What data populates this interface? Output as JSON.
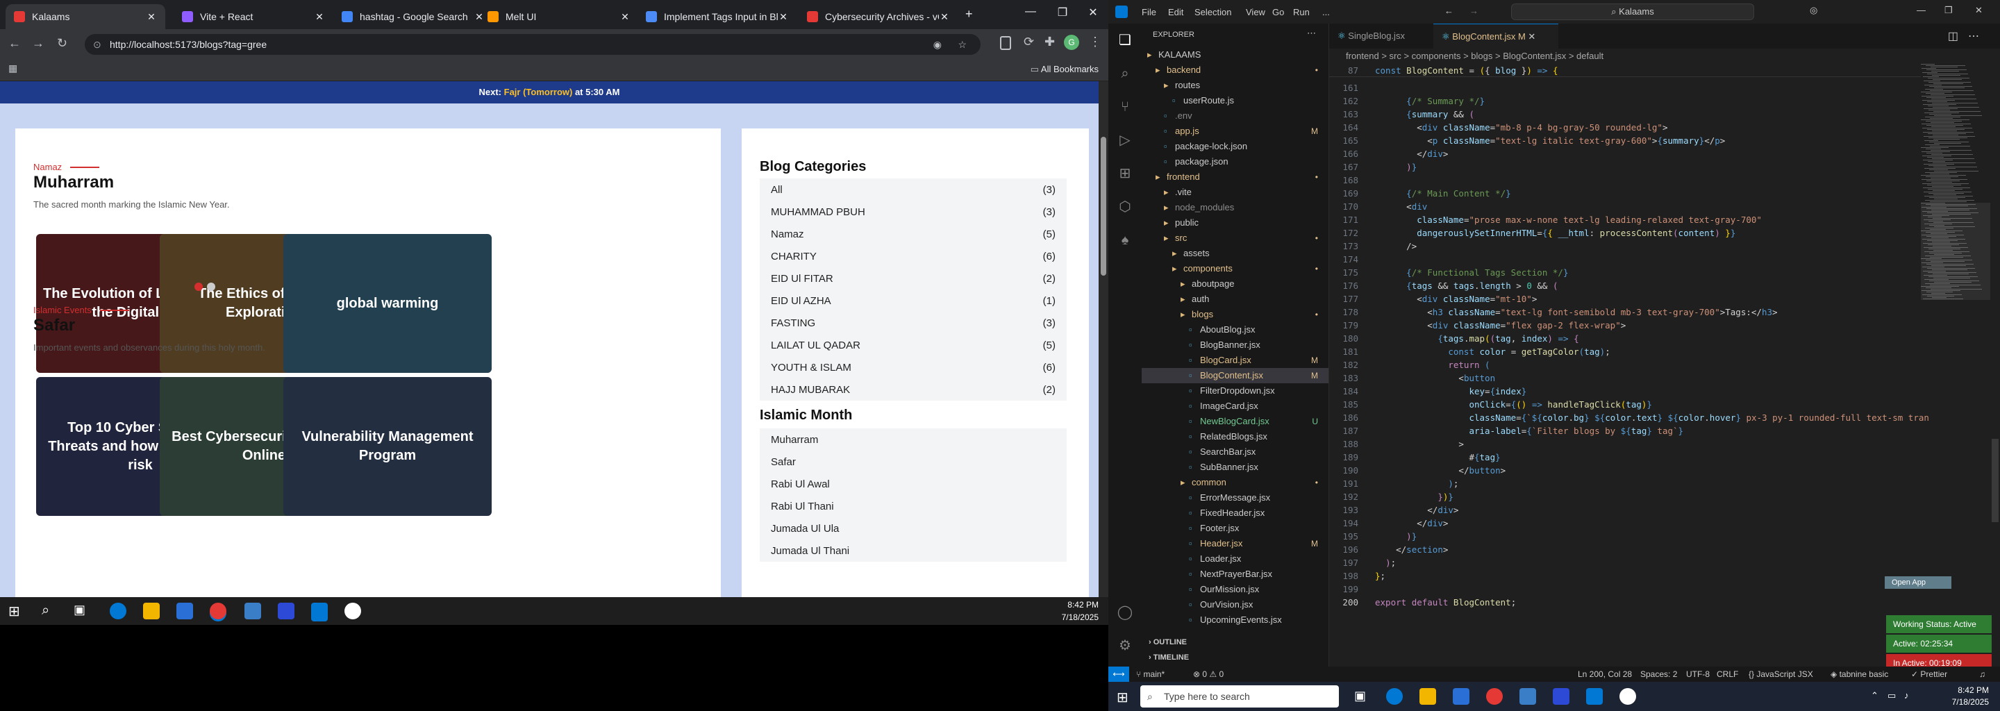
{
  "chrome": {
    "tabs": [
      {
        "title": "Kalaams",
        "color": "#e53935",
        "active": true
      },
      {
        "title": "Vite + React",
        "color": "#8e5cff",
        "active": false
      },
      {
        "title": "hashtag - Google Search",
        "color": "#4285f4",
        "active": false
      },
      {
        "title": "Melt UI",
        "color": "#ff9800",
        "active": false
      },
      {
        "title": "Implement Tags Input in Blo",
        "color": "#4c8bf5",
        "active": false
      },
      {
        "title": "Cybersecurity Archives - vCh",
        "color": "#e53935",
        "active": false
      }
    ],
    "url": "http://localhost:5173/blogs?tag=gree",
    "all_bookmarks": "All Bookmarks",
    "profile_initial": "G"
  },
  "page": {
    "prayer_prefix": "Next: ",
    "prayer_name": "Fajr (Tomorrow)",
    "prayer_time": " at 5:30 AM",
    "sections": [
      {
        "tag": "Namaz",
        "title": "Muharram",
        "desc": "The sacred month marking the Islamic New Year.",
        "cards": [
          {
            "title": "The Evolution of Language in the Digital Age",
            "bg": "#7b2a2e"
          },
          {
            "title": "The Ethics of Space Exploration",
            "bg": "#8a6a3a"
          },
          {
            "title": "global warming",
            "bg": "#3d6f8c"
          }
        ]
      },
      {
        "tag": "Islamic Events",
        "title": "Safar",
        "desc": "Important events and observances during this holy month.",
        "cards": [
          {
            "title": "Top 10 Cyber Security Threats and how to mitigate risk",
            "bg": "#3a3f6a"
          },
          {
            "title": "Best Cybersecurity Training Online",
            "bg": "#4a6a5a"
          },
          {
            "title": "Vulnerability Management Program",
            "bg": "#3e5070"
          }
        ]
      }
    ],
    "categories_title": "Blog Categories",
    "categories": [
      {
        "name": "All",
        "count": "(3)"
      },
      {
        "name": "MUHAMMAD PBUH",
        "count": "(3)"
      },
      {
        "name": "Namaz",
        "count": "(5)"
      },
      {
        "name": "CHARITY",
        "count": "(6)"
      },
      {
        "name": "EID Ul FITAR",
        "count": "(2)"
      },
      {
        "name": "EID Ul AZHA",
        "count": "(1)"
      },
      {
        "name": "FASTING",
        "count": "(3)"
      },
      {
        "name": "LAILAT UL QADAR",
        "count": "(5)"
      },
      {
        "name": "YOUTH & ISLAM",
        "count": "(6)"
      },
      {
        "name": "HAJJ MUBARAK",
        "count": "(2)"
      }
    ],
    "months_title": "Islamic Month",
    "months": [
      "Muharram",
      "Safar",
      "Rabi Ul Awal",
      "Rabi Ul Thani",
      "Jumada Ul Ula",
      "Jumada Ul Thani"
    ]
  },
  "taskbar_left": {
    "time": "8:42 PM",
    "date": "7/18/2025"
  },
  "vscode": {
    "menu": [
      "File",
      "Edit",
      "Selection",
      "View",
      "Go",
      "Run",
      "..."
    ],
    "search": "Kalaams",
    "explorer_title": "EXPLORER",
    "tabs": [
      {
        "title": "SingleBlog.jsx",
        "active": false
      },
      {
        "title": "BlogContent.jsx M",
        "active": true
      }
    ],
    "breadcrumbs": "frontend > src > components > blogs > BlogContent.jsx > default",
    "tree": [
      {
        "label": "KALAAMS",
        "indent": 0,
        "color": "#ccc",
        "mark": ""
      },
      {
        "label": "backend",
        "indent": 1,
        "color": "#e2c08d",
        "mark": "•"
      },
      {
        "label": "routes",
        "indent": 2,
        "color": "#ccc",
        "mark": ""
      },
      {
        "label": "userRoute.js",
        "indent": 3,
        "color": "#ccc",
        "mark": ""
      },
      {
        "label": ".env",
        "indent": 2,
        "color": "#8b8b8b",
        "mark": ""
      },
      {
        "label": "app.js",
        "indent": 2,
        "color": "#e2c08d",
        "mark": "M"
      },
      {
        "label": "package-lock.json",
        "indent": 2,
        "color": "#ccc",
        "mark": ""
      },
      {
        "label": "package.json",
        "indent": 2,
        "color": "#ccc",
        "mark": ""
      },
      {
        "label": "frontend",
        "indent": 1,
        "color": "#e2c08d",
        "mark": "•"
      },
      {
        "label": ".vite",
        "indent": 2,
        "color": "#ccc",
        "mark": ""
      },
      {
        "label": "node_modules",
        "indent": 2,
        "color": "#8b8b8b",
        "mark": ""
      },
      {
        "label": "public",
        "indent": 2,
        "color": "#ccc",
        "mark": ""
      },
      {
        "label": "src",
        "indent": 2,
        "color": "#e2c08d",
        "mark": "•"
      },
      {
        "label": "assets",
        "indent": 3,
        "color": "#ccc",
        "mark": ""
      },
      {
        "label": "components",
        "indent": 3,
        "color": "#e2c08d",
        "mark": "•"
      },
      {
        "label": "aboutpage",
        "indent": 4,
        "color": "#ccc",
        "mark": ""
      },
      {
        "label": "auth",
        "indent": 4,
        "color": "#ccc",
        "mark": ""
      },
      {
        "label": "blogs",
        "indent": 4,
        "color": "#e2c08d",
        "mark": "•"
      },
      {
        "label": "AboutBlog.jsx",
        "indent": 5,
        "color": "#ccc",
        "mark": ""
      },
      {
        "label": "BlogBanner.jsx",
        "indent": 5,
        "color": "#ccc",
        "mark": ""
      },
      {
        "label": "BlogCard.jsx",
        "indent": 5,
        "color": "#e2c08d",
        "mark": "M"
      },
      {
        "label": "BlogContent.jsx",
        "indent": 5,
        "color": "#e2c08d",
        "mark": "M"
      },
      {
        "label": "FilterDropdown.jsx",
        "indent": 5,
        "color": "#ccc",
        "mark": ""
      },
      {
        "label": "ImageCard.jsx",
        "indent": 5,
        "color": "#ccc",
        "mark": ""
      },
      {
        "label": "NewBlogCard.jsx",
        "indent": 5,
        "color": "#73c991",
        "mark": "U"
      },
      {
        "label": "RelatedBlogs.jsx",
        "indent": 5,
        "color": "#ccc",
        "mark": ""
      },
      {
        "label": "SearchBar.jsx",
        "indent": 5,
        "color": "#ccc",
        "mark": ""
      },
      {
        "label": "SubBanner.jsx",
        "indent": 5,
        "color": "#ccc",
        "mark": ""
      },
      {
        "label": "common",
        "indent": 4,
        "color": "#e2c08d",
        "mark": "•"
      },
      {
        "label": "ErrorMessage.jsx",
        "indent": 5,
        "color": "#ccc",
        "mark": ""
      },
      {
        "label": "FixedHeader.jsx",
        "indent": 5,
        "color": "#ccc",
        "mark": ""
      },
      {
        "label": "Footer.jsx",
        "indent": 5,
        "color": "#ccc",
        "mark": ""
      },
      {
        "label": "Header.jsx",
        "indent": 5,
        "color": "#e2c08d",
        "mark": "M"
      },
      {
        "label": "Loader.jsx",
        "indent": 5,
        "color": "#ccc",
        "mark": ""
      },
      {
        "label": "NextPrayerBar.jsx",
        "indent": 5,
        "color": "#ccc",
        "mark": ""
      },
      {
        "label": "OurMission.jsx",
        "indent": 5,
        "color": "#ccc",
        "mark": ""
      },
      {
        "label": "OurVision.jsx",
        "indent": 5,
        "color": "#ccc",
        "mark": ""
      },
      {
        "label": "UpcomingEvents.jsx",
        "indent": 5,
        "color": "#ccc",
        "mark": ""
      }
    ],
    "outline": "OUTLINE",
    "timeline": "TIMELINE",
    "code": [
      {
        "n": "87",
        "t": "<span class='t'>const</span> <span class='f'>BlogContent</span> <span class='p'>=</span> <span class='y'>(</span><span class='p'>{ </span><span class='v'>blog</span><span class='p'> }</span><span class='y'>)</span> <span class='t'>=&gt;</span> <span class='y'>{</span>"
      },
      {
        "n": "161",
        "t": "<span class='p'>    </span>"
      },
      {
        "n": "162",
        "t": "      <span class='t'>{</span><span class='c'>/* Summary */</span><span class='t'>}</span>"
      },
      {
        "n": "163",
        "t": "      <span class='t'>{</span><span class='v'>summary</span> <span class='p'>&amp;&amp;</span> <span class='k'>(</span>"
      },
      {
        "n": "164",
        "t": "        <span class='p'>&lt;</span><span class='t'>div</span> <span class='v'>className</span><span class='p'>=</span><span class='s'>\"mb-8 p-4 bg-gray-50 rounded-lg\"</span><span class='p'>&gt;</span>"
      },
      {
        "n": "165",
        "t": "          <span class='p'>&lt;</span><span class='t'>p</span> <span class='v'>className</span><span class='p'>=</span><span class='s'>\"text-lg italic text-gray-600\"</span><span class='p'>&gt;</span><span class='t'>{</span><span class='v'>summary</span><span class='t'>}</span><span class='p'>&lt;/</span><span class='t'>p</span><span class='p'>&gt;</span>"
      },
      {
        "n": "166",
        "t": "        <span class='p'>&lt;/</span><span class='t'>div</span><span class='p'>&gt;</span>"
      },
      {
        "n": "167",
        "t": "      <span class='k'>)</span><span class='t'>}</span>"
      },
      {
        "n": "168",
        "t": ""
      },
      {
        "n": "169",
        "t": "      <span class='t'>{</span><span class='c'>/* Main Content */</span><span class='t'>}</span>"
      },
      {
        "n": "170",
        "t": "      <span class='p'>&lt;</span><span class='t'>div</span>"
      },
      {
        "n": "171",
        "t": "        <span class='v'>className</span><span class='p'>=</span><span class='s'>\"prose max-w-none text-lg leading-relaxed text-gray-700\"</span>"
      },
      {
        "n": "172",
        "t": "        <span class='v'>dangerouslySetInnerHTML</span><span class='p'>=</span><span class='t'>{</span><span class='y'>{</span> <span class='v'>__html</span><span class='p'>:</span> <span class='f'>processContent</span><span class='k'>(</span><span class='v'>content</span><span class='k'>)</span> <span class='y'>}</span><span class='t'>}</span>"
      },
      {
        "n": "173",
        "t": "      <span class='p'>/&gt;</span>"
      },
      {
        "n": "174",
        "t": ""
      },
      {
        "n": "175",
        "t": "      <span class='t'>{</span><span class='c'>/* Functional Tags Section */</span><span class='t'>}</span>"
      },
      {
        "n": "176",
        "t": "      <span class='t'>{</span><span class='v'>tags</span> <span class='p'>&amp;&amp;</span> <span class='v'>tags</span><span class='p'>.</span><span class='v'>length</span> <span class='p'>&gt;</span> <span class='g'>0</span> <span class='p'>&amp;&amp;</span> <span class='k'>(</span>"
      },
      {
        "n": "177",
        "t": "        <span class='p'>&lt;</span><span class='t'>div</span> <span class='v'>className</span><span class='p'>=</span><span class='s'>\"mt-10\"</span><span class='p'>&gt;</span>"
      },
      {
        "n": "178",
        "t": "          <span class='p'>&lt;</span><span class='t'>h3</span> <span class='v'>className</span><span class='p'>=</span><span class='s'>\"text-lg font-semibold mb-3 text-gray-700\"</span><span class='p'>&gt;Tags:&lt;/</span><span class='t'>h3</span><span class='p'>&gt;</span>"
      },
      {
        "n": "179",
        "t": "          <span class='p'>&lt;</span><span class='t'>div</span> <span class='v'>className</span><span class='p'>=</span><span class='s'>\"flex gap-2 flex-wrap\"</span><span class='p'>&gt;</span>"
      },
      {
        "n": "180",
        "t": "            <span class='t'>{</span><span class='v'>tags</span><span class='p'>.</span><span class='f'>map</span><span class='y'>(</span><span class='k'>(</span><span class='v'>tag</span><span class='p'>, </span><span class='v'>index</span><span class='k'>)</span> <span class='t'>=&gt;</span> <span class='k'>{</span>"
      },
      {
        "n": "181",
        "t": "              <span class='t'>const</span> <span class='v'>color</span> <span class='p'>=</span> <span class='f'>getTagColor</span><span class='t'>(</span><span class='v'>tag</span><span class='t'>)</span><span class='p'>;</span>"
      },
      {
        "n": "182",
        "t": "              <span class='k'>return</span> <span class='t'>(</span>"
      },
      {
        "n": "183",
        "t": "                <span class='p'>&lt;</span><span class='t'>button</span>"
      },
      {
        "n": "184",
        "t": "                  <span class='v'>key</span><span class='p'>=</span><span class='t'>{</span><span class='v'>index</span><span class='t'>}</span>"
      },
      {
        "n": "185",
        "t": "                  <span class='v'>onClick</span><span class='p'>=</span><span class='t'>{</span><span class='y'>()</span> <span class='t'>=&gt;</span> <span class='f'>handleTagClick</span><span class='y'>(</span><span class='v'>tag</span><span class='y'>)</span><span class='t'>}</span>"
      },
      {
        "n": "186",
        "t": "                  <span class='v'>className</span><span class='p'>=</span><span class='t'>{</span><span class='s'>`</span><span class='t'>${</span><span class='v'>color</span><span class='p'>.</span><span class='v'>bg</span><span class='t'>}</span> <span class='t'>${</span><span class='v'>color</span><span class='p'>.</span><span class='v'>text</span><span class='t'>}</span> <span class='t'>${</span><span class='v'>color</span><span class='p'>.</span><span class='v'>hover</span><span class='t'>}</span><span class='s'> px-3 py-1 rounded-full text-sm tran</span>"
      },
      {
        "n": "187",
        "t": "                  <span class='v'>aria-label</span><span class='p'>=</span><span class='t'>{</span><span class='s'>`Filter blogs by </span><span class='t'>${</span><span class='v'>tag</span><span class='t'>}</span><span class='s'> tag`</span><span class='t'>}</span>"
      },
      {
        "n": "188",
        "t": "                <span class='p'>&gt;</span>"
      },
      {
        "n": "189",
        "t": "                  <span class='p'>#</span><span class='t'>{</span><span class='v'>tag</span><span class='t'>}</span>"
      },
      {
        "n": "190",
        "t": "                <span class='p'>&lt;/</span><span class='t'>button</span><span class='p'>&gt;</span>"
      },
      {
        "n": "191",
        "t": "              <span class='t'>)</span><span class='p'>;</span>"
      },
      {
        "n": "192",
        "t": "            <span class='k'>}</span><span class='y'>)</span><span class='t'>}</span>"
      },
      {
        "n": "193",
        "t": "          <span class='p'>&lt;/</span><span class='t'>div</span><span class='p'>&gt;</span>"
      },
      {
        "n": "194",
        "t": "        <span class='p'>&lt;/</span><span class='t'>div</span><span class='p'>&gt;</span>"
      },
      {
        "n": "195",
        "t": "      <span class='k'>)</span><span class='t'>}</span>"
      },
      {
        "n": "196",
        "t": "    <span class='p'>&lt;/</span><span class='t'>section</span><span class='p'>&gt;</span>"
      },
      {
        "n": "197",
        "t": "  <span class='k'>)</span><span class='p'>;</span>"
      },
      {
        "n": "198",
        "t": "<span class='y'>}</span><span class='p'>;</span>"
      },
      {
        "n": "199",
        "t": ""
      },
      {
        "n": "200",
        "t": "<span class='k'>export</span> <span class='k'>default</span> <span class='f'>BlogContent</span><span class='p'>;</span>"
      }
    ],
    "status": {
      "branch": "main*",
      "problems": "0 ⚠ 0",
      "position": "Ln 200, Col 28",
      "spaces": "Spaces: 2",
      "encoding": "UTF-8",
      "eol": "CRLF",
      "language": "JavaScript JSX",
      "tabnine": "tabnine basic",
      "prettier": "Prettier"
    },
    "badges": {
      "working": "Working Status: Active",
      "active": "Active: 02:25:34",
      "inactive": "In Active: 00:19:09",
      "open_app": "Open App"
    }
  },
  "taskbar_right": {
    "search": "Type here to search",
    "time": "8:42 PM",
    "date": "7/18/2025"
  }
}
